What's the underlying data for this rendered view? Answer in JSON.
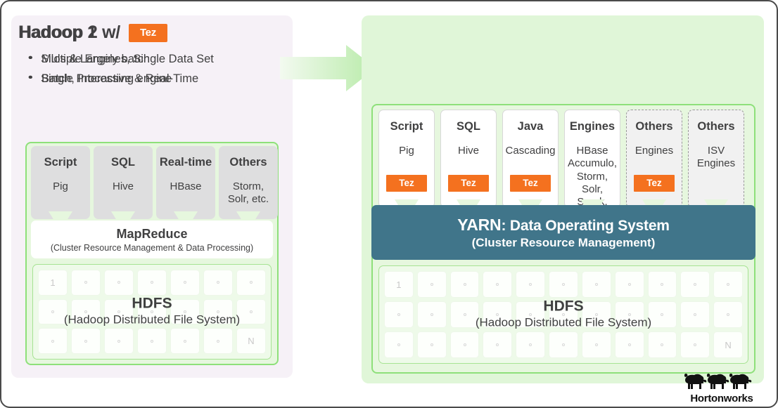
{
  "left_panel": {
    "title": "Hadoop 1",
    "bullets": [
      "Silos & Largely batch",
      "Single Processing engine"
    ],
    "engines": [
      {
        "title": "Script",
        "sub": "Pig"
      },
      {
        "title": "SQL",
        "sub": "Hive"
      },
      {
        "title": "Real-time",
        "sub": "HBase"
      },
      {
        "title": "Others",
        "sub": "Storm,\nSolr, etc."
      }
    ],
    "mapreduce": {
      "title": "MapReduce",
      "subtitle": "(Cluster Resource Management & Data Processing)"
    },
    "hdfs": {
      "title": "HDFS",
      "subtitle": "(Hadoop Distributed File System)",
      "first_label": "1",
      "last_label": "N",
      "columns": 7,
      "rows": 3
    }
  },
  "right_panel": {
    "title": "Hadoop 2 w/",
    "title_badge": "Tez",
    "bullets": [
      "Multiple Engines, Single Data Set",
      "Batch, Interactive & Real-Time"
    ],
    "engines": [
      {
        "title": "Script",
        "sub": "Pig",
        "tez": "Tez",
        "style": "white"
      },
      {
        "title": "SQL",
        "sub": "Hive",
        "tez": "Tez",
        "style": "white"
      },
      {
        "title": "Java",
        "sub": "Cascading",
        "tez": "Tez",
        "style": "white"
      },
      {
        "title": "Engines",
        "sub": "HBase\nAccumulo,\nStorm, Solr,\nSpark.",
        "tez": "",
        "style": "white"
      },
      {
        "title": "Others",
        "sub": "Engines",
        "tez": "Tez",
        "style": "dashed"
      },
      {
        "title": "Others",
        "sub": "ISV\nEngines",
        "tez": "",
        "style": "dashed"
      }
    ],
    "yarn": {
      "name": "YARN",
      "tagline": ": Data Operating System",
      "subtitle": "(Cluster Resource Management)"
    },
    "hdfs": {
      "title": "HDFS",
      "subtitle": "(Hadoop Distributed File System)",
      "first_label": "1",
      "last_label": "N",
      "columns": 11,
      "rows": 3
    }
  },
  "branding": {
    "name": "Hortonworks"
  },
  "colors": {
    "tez_orange": "#f4711f",
    "yarn_teal": "#40758a",
    "panel_green": "#e0f6d8",
    "panel_lavender": "#f6f1f7",
    "stack_green_border": "#8ee07a",
    "text_dark": "#404041"
  }
}
